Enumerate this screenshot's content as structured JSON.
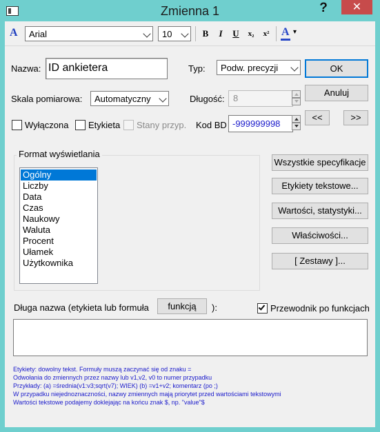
{
  "window": {
    "title": "Zmienna 1",
    "help": "?",
    "close": "✕"
  },
  "toolbar": {
    "font_icon": "A",
    "font": "Arial",
    "size": "10",
    "bold": "B",
    "italic": "I",
    "underline": "U",
    "subscript": "x₂",
    "superscript": "x²",
    "color_letter": "A",
    "color_arrow": "▾",
    "accent_color": "#1f3fbf",
    "text_color": "#2747c7"
  },
  "form": {
    "name_label": "Nazwa:",
    "name_value": "ID ankietera",
    "type_label": "Typ:",
    "type_value": "Podw. precyzji",
    "scale_label": "Skala pomiarowa:",
    "scale_value": "Automatyczny",
    "length_label": "Długość:",
    "length_value": "8",
    "excluded_label": "Wyłączona",
    "label_label": "Etykieta",
    "states_label": "Stany przyp.",
    "bd_label": "Kod BD",
    "bd_value": "-999999998"
  },
  "buttons": {
    "ok": "OK",
    "cancel": "Anuluj",
    "prev": "<<",
    "next": ">>",
    "all_specs": "Wszystkie specyfikacje",
    "text_labels": "Etykiety tekstowe...",
    "values_stats": "Wartości, statystyki...",
    "properties": "Właściwości...",
    "sets": "[ Zestawy ]..."
  },
  "format": {
    "title": "Format wyświetlania",
    "items": [
      "Ogólny",
      "Liczby",
      "Data",
      "Czas",
      "Naukowy",
      "Waluta",
      "Procent",
      "Ułamek",
      "Użytkownika"
    ],
    "selected": "Ogólny"
  },
  "longname": {
    "label": "Długa nazwa (etykieta lub formuła",
    "func_button": "funkcją",
    "suffix": "):",
    "wizard_label": "Przewodnik po funkcjach",
    "wizard_checked": true,
    "value": ""
  },
  "notes": [
    "Etykiety:  dowolny tekst. Formuły muszą zaczynać się od znaku =",
    "Odwołania do zmiennych przez nazwy lub v1,v2,  v0 to numer przypadku",
    "Przykłady: (a) =średnia(v1:v3;sqrt(v7); WIEK) (b) =v1+v2; komentarz (po ;)",
    "W przypadku niejednoznaczności, nazwy zmiennych mają priorytet przed wartościami tekstowymi",
    "Wartości tekstowe podajemy doklejając na końcu znak $, np. \"value\"$"
  ]
}
